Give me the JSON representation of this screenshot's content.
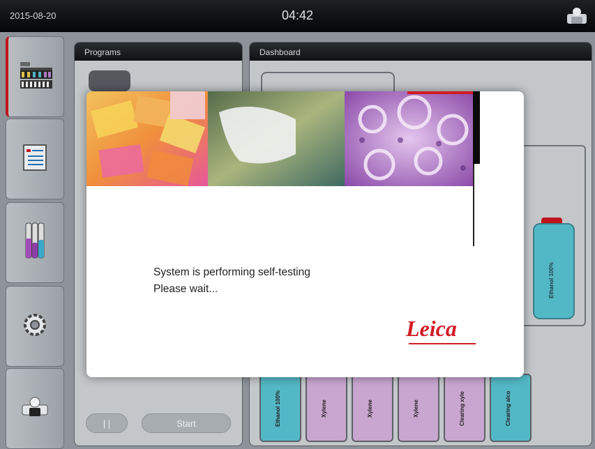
{
  "header": {
    "date": "2015-08-20",
    "time": "04:42",
    "user_icon": "user-icon"
  },
  "sidebar": {
    "items": [
      {
        "name": "dashboard-tab",
        "icon": "dashboard-icon",
        "active": true
      },
      {
        "name": "programs-tab",
        "icon": "program-list-icon"
      },
      {
        "name": "reagents-tab",
        "icon": "reagent-tubes-icon"
      },
      {
        "name": "settings-tab",
        "icon": "gear-icon"
      },
      {
        "name": "user-tab",
        "icon": "user-icon"
      }
    ]
  },
  "programs_panel": {
    "title": "Programs",
    "pause_label": "| |",
    "start_label": "Start"
  },
  "dashboard_panel": {
    "title": "Dashboard",
    "bottle_label": "Ethanol 100%",
    "reagents": [
      {
        "label": "Ethanol 100%",
        "color": "#53b8c6"
      },
      {
        "label": "Xylene",
        "color": "#c9a6cf"
      },
      {
        "label": "Xylene",
        "color": "#c9a6cf"
      },
      {
        "label": "Xylene",
        "color": "#c9a6cf"
      },
      {
        "label": "Clearing xyle",
        "color": "#c9a6cf"
      },
      {
        "label": "Clearing alco",
        "color": "#53b8c6"
      }
    ]
  },
  "modal": {
    "line1": "System is performing self-testing",
    "line2": "Please wait...",
    "logo": "Leica",
    "accent_color": "#d21b24"
  }
}
